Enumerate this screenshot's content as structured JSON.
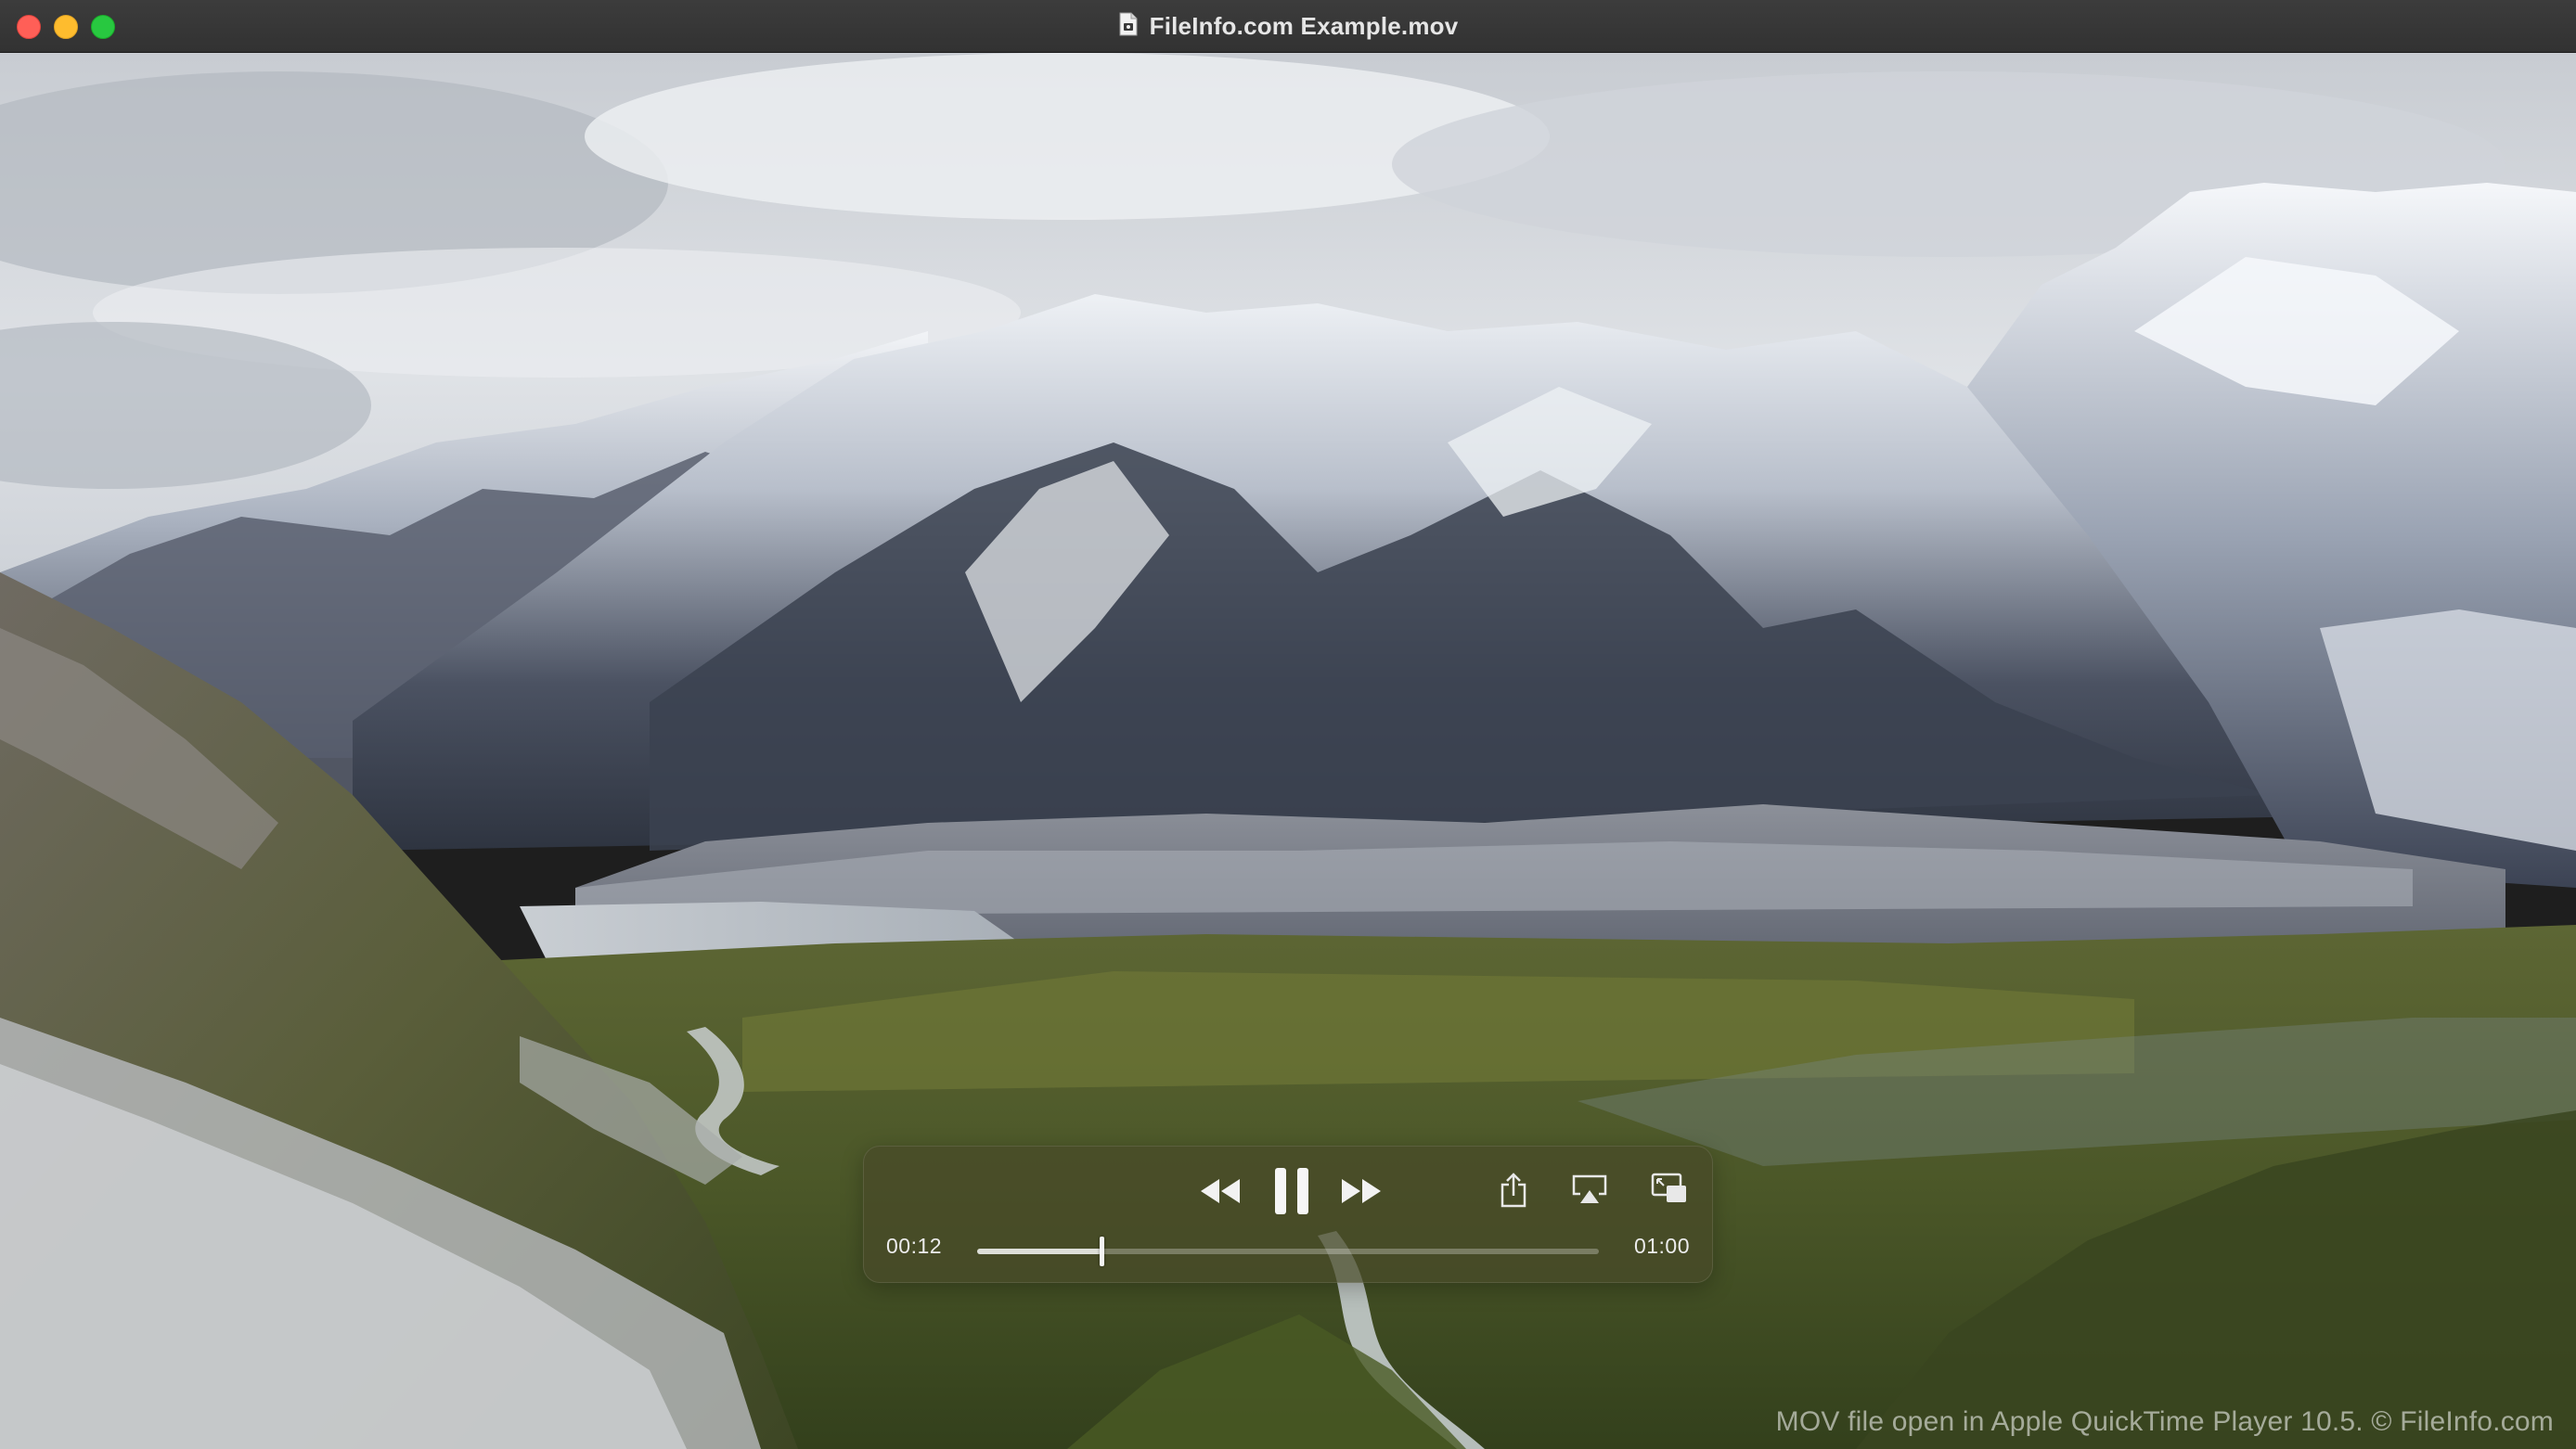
{
  "window": {
    "title": "FileInfo.com Example.mov",
    "document_icon": "document-icon",
    "traffic_lights": {
      "close": "#ff5f57",
      "minimize": "#febc2e",
      "maximize": "#28c840"
    }
  },
  "player": {
    "state": "playing",
    "elapsed": "00:12",
    "duration": "01:00",
    "progress": 0.2,
    "controls": {
      "rewind_icon": "rewind-icon",
      "pause_icon": "pause-icon",
      "fast_forward_icon": "fast-forward-icon",
      "share_icon": "share-icon",
      "airplay_icon": "airplay-icon",
      "pip_icon": "picture-in-picture-icon"
    }
  },
  "watermark": "MOV file open in Apple QuickTime Player 10.5. © FileInfo.com"
}
